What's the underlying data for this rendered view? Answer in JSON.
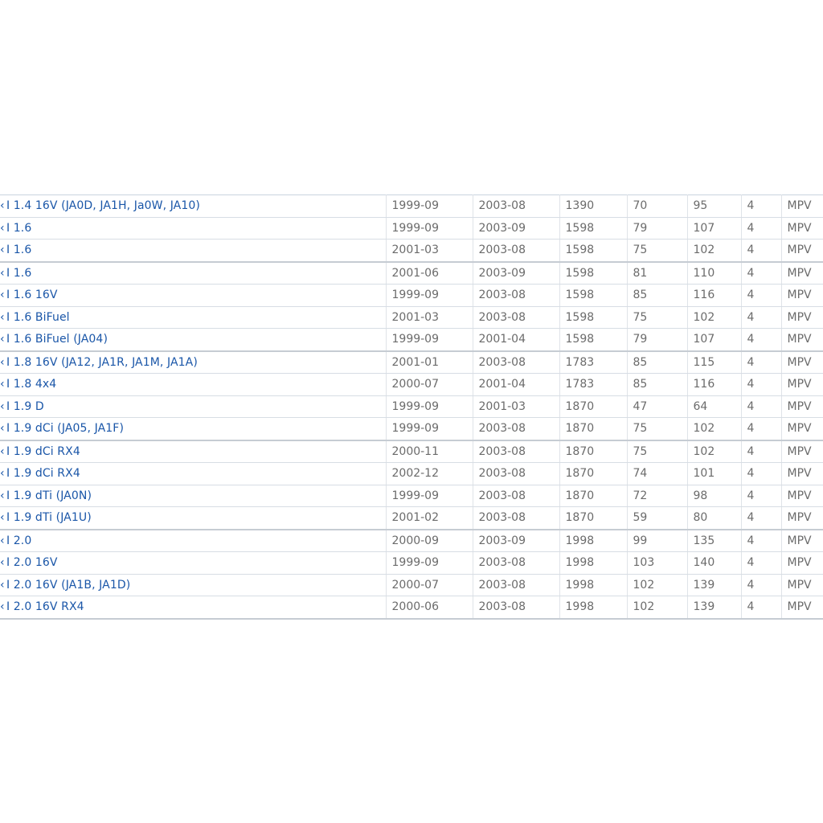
{
  "table": {
    "rows": [
      {
        "model": "I 1.4 16V (JA0D, JA1H, Ja0W, JA10)",
        "from": "1999-09",
        "to": "2003-08",
        "ccm": "1390",
        "kw": "70",
        "hp": "95",
        "cyl": "4",
        "body": "MPV"
      },
      {
        "model": "I 1.6",
        "from": "1999-09",
        "to": "2003-09",
        "ccm": "1598",
        "kw": "79",
        "hp": "107",
        "cyl": "4",
        "body": "MPV"
      },
      {
        "model": "I 1.6",
        "from": "2001-03",
        "to": "2003-08",
        "ccm": "1598",
        "kw": "75",
        "hp": "102",
        "cyl": "4",
        "body": "MPV"
      },
      {
        "model": "I 1.6",
        "from": "2001-06",
        "to": "2003-09",
        "ccm": "1598",
        "kw": "81",
        "hp": "110",
        "cyl": "4",
        "body": "MPV"
      },
      {
        "model": "I 1.6 16V",
        "from": "1999-09",
        "to": "2003-08",
        "ccm": "1598",
        "kw": "85",
        "hp": "116",
        "cyl": "4",
        "body": "MPV"
      },
      {
        "model": "I 1.6 BiFuel",
        "from": "2001-03",
        "to": "2003-08",
        "ccm": "1598",
        "kw": "75",
        "hp": "102",
        "cyl": "4",
        "body": "MPV"
      },
      {
        "model": "I 1.6 BiFuel (JA04)",
        "from": "1999-09",
        "to": "2001-04",
        "ccm": "1598",
        "kw": "79",
        "hp": "107",
        "cyl": "4",
        "body": "MPV"
      },
      {
        "model": "I 1.8 16V (JA12, JA1R, JA1M, JA1A)",
        "from": "2001-01",
        "to": "2003-08",
        "ccm": "1783",
        "kw": "85",
        "hp": "115",
        "cyl": "4",
        "body": "MPV"
      },
      {
        "model": "I 1.8 4x4",
        "from": "2000-07",
        "to": "2001-04",
        "ccm": "1783",
        "kw": "85",
        "hp": "116",
        "cyl": "4",
        "body": "MPV"
      },
      {
        "model": "I 1.9 D",
        "from": "1999-09",
        "to": "2001-03",
        "ccm": "1870",
        "kw": "47",
        "hp": "64",
        "cyl": "4",
        "body": "MPV"
      },
      {
        "model": "I 1.9 dCi (JA05, JA1F)",
        "from": "1999-09",
        "to": "2003-08",
        "ccm": "1870",
        "kw": "75",
        "hp": "102",
        "cyl": "4",
        "body": "MPV"
      },
      {
        "model": "I 1.9 dCi RX4",
        "from": "2000-11",
        "to": "2003-08",
        "ccm": "1870",
        "kw": "75",
        "hp": "102",
        "cyl": "4",
        "body": "MPV"
      },
      {
        "model": "I 1.9 dCi RX4",
        "from": "2002-12",
        "to": "2003-08",
        "ccm": "1870",
        "kw": "74",
        "hp": "101",
        "cyl": "4",
        "body": "MPV"
      },
      {
        "model": "I 1.9 dTi (JA0N)",
        "from": "1999-09",
        "to": "2003-08",
        "ccm": "1870",
        "kw": "72",
        "hp": "98",
        "cyl": "4",
        "body": "MPV"
      },
      {
        "model": "I 1.9 dTi (JA1U)",
        "from": "2001-02",
        "to": "2003-08",
        "ccm": "1870",
        "kw": "59",
        "hp": "80",
        "cyl": "4",
        "body": "MPV"
      },
      {
        "model": "I 2.0",
        "from": "2000-09",
        "to": "2003-09",
        "ccm": "1998",
        "kw": "99",
        "hp": "135",
        "cyl": "4",
        "body": "MPV"
      },
      {
        "model": "I 2.0 16V",
        "from": "1999-09",
        "to": "2003-08",
        "ccm": "1998",
        "kw": "103",
        "hp": "140",
        "cyl": "4",
        "body": "MPV"
      },
      {
        "model": "I 2.0 16V (JA1B, JA1D)",
        "from": "2000-07",
        "to": "2003-08",
        "ccm": "1998",
        "kw": "102",
        "hp": "139",
        "cyl": "4",
        "body": "MPV"
      },
      {
        "model": "I 2.0 16V RX4",
        "from": "2000-06",
        "to": "2003-08",
        "ccm": "1998",
        "kw": "102",
        "hp": "139",
        "cyl": "4",
        "body": "MPV"
      }
    ],
    "group_end_rows": [
      2,
      6,
      10,
      14,
      18
    ]
  }
}
